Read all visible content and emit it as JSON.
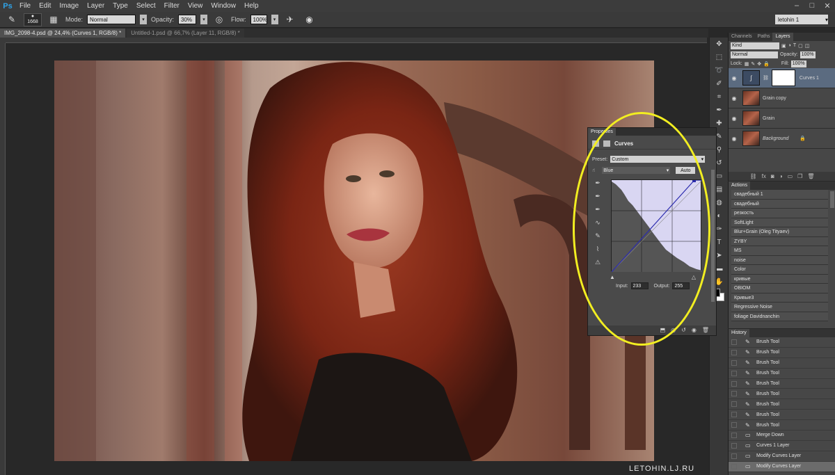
{
  "app": {
    "logo": "Ps"
  },
  "menu": [
    "File",
    "Edit",
    "Image",
    "Layer",
    "Type",
    "Select",
    "Filter",
    "View",
    "Window",
    "Help"
  ],
  "window_controls": [
    "–",
    "□",
    "✕"
  ],
  "options": {
    "brush_size": "1668",
    "mode_label": "Mode:",
    "mode_value": "Normal",
    "opacity_label": "Opacity:",
    "opacity_value": "30%",
    "flow_label": "Flow:",
    "flow_value": "100%",
    "workspace": "letohin 1"
  },
  "doc_tabs": [
    "IMG_2098-4.psd @ 24,4% (Curves 1, RGB/8) *",
    "Untitled-1.psd @ 66,7% (Layer 11, RGB/8) *"
  ],
  "watermark": "LETOHIN.LJ.RU",
  "layers_panel": {
    "tabs": [
      "Channels",
      "Paths",
      "Layers"
    ],
    "filter": "Kind",
    "blend": "Normal",
    "opacity_label": "Opacity:",
    "opacity_value": "100%",
    "lock_label": "Lock:",
    "fill_label": "Fill:",
    "fill_value": "100%",
    "layers": [
      {
        "name": "Curves 1",
        "selected": true
      },
      {
        "name": "Grain copy",
        "selected": false
      },
      {
        "name": "Grain",
        "selected": false
      },
      {
        "name": "Background",
        "selected": false
      }
    ]
  },
  "actions_panel": {
    "tab": "Actions",
    "items": [
      "свадебный 1",
      "свадебный",
      "резкость",
      "SoftLight",
      "Blur+Grain (Oleg Tityaev)",
      "ZYBY",
      "MS",
      "noise",
      "Color",
      "кривые",
      "OBIOM",
      "Кривые3",
      "Regressive Noise",
      "foliage Davidnanchin"
    ]
  },
  "history_panel": {
    "tab": "History",
    "items": [
      "Brush Tool",
      "Brush Tool",
      "Brush Tool",
      "Brush Tool",
      "Brush Tool",
      "Brush Tool",
      "Brush Tool",
      "Brush Tool",
      "Brush Tool",
      "Merge Down",
      "Curves 1 Layer",
      "Modify Curves Layer",
      "Modify Curves Layer"
    ],
    "selected_index": 12
  },
  "properties": {
    "tab": "Properties",
    "title": "Curves",
    "preset_label": "Preset:",
    "preset_value": "Custom",
    "channel": "Blue",
    "auto_label": "Auto",
    "input_label": "Input:",
    "input_value": "233",
    "output_label": "Output:",
    "output_value": "255"
  },
  "colors": {
    "highlight": "#f2ee21",
    "curve_line": "#2c2cae",
    "histogram": "#555555"
  }
}
